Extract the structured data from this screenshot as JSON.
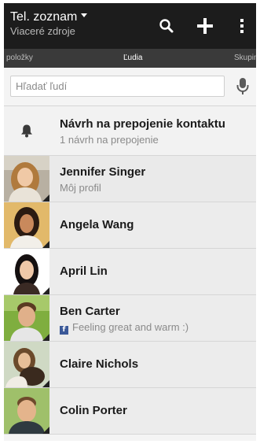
{
  "header": {
    "title": "Tel. zoznam",
    "subtitle": "Viaceré zdroje",
    "icons": [
      "search-icon",
      "add-icon",
      "more-icon"
    ]
  },
  "tabs": {
    "left": "položky",
    "center": "Ľudia",
    "right": "Skupin"
  },
  "search": {
    "placeholder": "Hľadať ľudí",
    "value": ""
  },
  "suggestion": {
    "title": "Návrh na prepojenie kontaktu",
    "subtitle": "1 návrh na prepojenie"
  },
  "contacts": [
    {
      "name": "Jennifer Singer",
      "subtitle": "Môj profil"
    },
    {
      "name": "Angela Wang"
    },
    {
      "name": "April Lin"
    },
    {
      "name": "Ben Carter",
      "status": "Feeling great and warm :)"
    },
    {
      "name": "Claire Nichols"
    },
    {
      "name": "Colin Porter"
    }
  ],
  "colors": {
    "header_bg": "#1c1c1c",
    "tabs_bg": "#3a3a3a",
    "list_bg": "#ececec",
    "facebook": "#3b5998"
  }
}
